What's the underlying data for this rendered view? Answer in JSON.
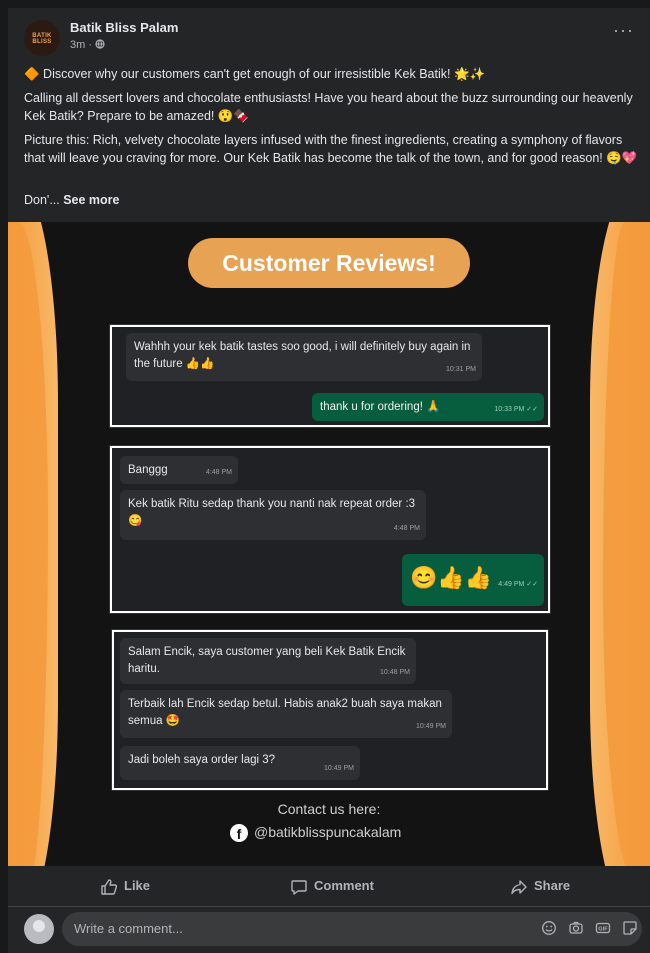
{
  "post": {
    "page_name": "Batik Bliss Palam",
    "avatar_text": "BATIK BLISS",
    "time": "3m · ",
    "globe_icon": "globe-icon",
    "more_icon": "ellipsis-icon",
    "paragraph1": "🔶 Discover why our customers can't get enough of our irresistible Kek Batik! 🌟✨",
    "paragraph2": "Calling all dessert lovers and chocolate enthusiasts! Have you heard about the buzz surrounding our heavenly Kek Batik? Prepare to be amazed! 😲🍫",
    "paragraph3": "Picture this: Rich, velvety chocolate layers infused with the finest ingredients, creating a symphony of flavors that will leave you craving for more. Our Kek Batik has become the talk of the town, and for good reason! 🤤💖",
    "paragraph4_start": "Don'... ",
    "see_more": "See more"
  },
  "image": {
    "title": "Customer Reviews!",
    "review1": {
      "incoming": "Wahhh your kek batik tastes soo good, i will definitely buy again in the future 👍👍",
      "incoming_time": "10:31 PM",
      "outgoing": "thank u for ordering! 🙏",
      "outgoing_time": "10:33 PM ✓✓"
    },
    "review2": {
      "msg1": "Banggg",
      "msg1_time": "4:48 PM",
      "msg2": "Kek batik Ritu sedap thank you nanti nak repeat order :3 😋",
      "msg2_time": "4:48 PM",
      "outgoing": "😊👍👍",
      "outgoing_time": "4:49 PM ✓✓"
    },
    "review3": {
      "msg1": "Salam Encik, saya customer yang beli Kek Batik Encik haritu.",
      "msg1_time": "10:48 PM",
      "msg2": "Terbaik lah Encik sedap betul. Habis anak2 buah saya makan semua 🤩",
      "msg2_time": "10:49 PM",
      "msg3": "Jadi boleh saya order lagi 3?",
      "msg3_time": "10:49 PM"
    },
    "contact_label": "Contact us here:",
    "contact_handle": "@batikblisspuncakalam",
    "facebook_icon": "facebook-icon"
  },
  "actions": {
    "like": "Like",
    "comment": "Comment",
    "share": "Share"
  },
  "comment_box": {
    "placeholder": "Write a comment...",
    "icons": [
      "emoji-icon",
      "camera-icon",
      "gif-icon",
      "sticker-icon"
    ]
  }
}
